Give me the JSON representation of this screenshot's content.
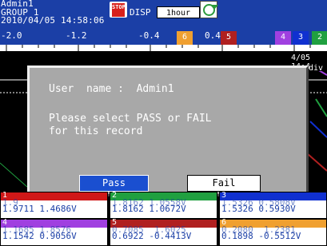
{
  "header": {
    "user": "Admin1",
    "group": "GROUP 1",
    "datetime": "2010/04/05 14:58:06",
    "stop_text": "STOP",
    "disp_label": "DISP",
    "timebase": "1hour"
  },
  "scale": {
    "ticks": [
      "-2.0",
      "-1.2",
      "-0.4",
      "0.4",
      ".2",
      "2"
    ],
    "markers": [
      {
        "label": "6",
        "color": "#f0a030"
      },
      {
        "label": "5",
        "color": "#b02020"
      },
      {
        "label": "4",
        "color": "#a040e0"
      },
      {
        "label": "3",
        "color": "#1030d0"
      },
      {
        "label": "2",
        "color": "#20a040"
      }
    ]
  },
  "trend": {
    "date_label": "4/05 14:4",
    "div_label": "div"
  },
  "dialog": {
    "user_line": "User  name :  Admin1",
    "message_line1": "Please select PASS or FAIL",
    "message_line2": "for this record",
    "pass_label": "Pass",
    "fail_label": "Fail"
  },
  "panels": [
    {
      "ch": "1",
      "color": "#d01818",
      "line1": "1.9",
      "line2": "1.9711 1.4686V"
    },
    {
      "ch": "2",
      "color": "#20a040",
      "line1": "1.8162 1.0558V",
      "line2": "1.8162 1.0672V"
    },
    {
      "ch": "3",
      "color": "#1030d0",
      "line1": "1.5326 0.5808V",
      "line2": "1.5326 0.5930V"
    },
    {
      "ch": "4",
      "color": "#a040e0",
      "line1": "1.1685 1.8576",
      "line2": "1.1542 0.9056V"
    },
    {
      "ch": "5",
      "color": "#b02020",
      "line1": "0.7085  1.6025",
      "line2": "0.6922 -0.4413V"
    },
    {
      "ch": "6",
      "color": "#f0a030",
      "line1": "0.2080  1.2381",
      "line2": "0.1898 -0.5512V"
    }
  ]
}
